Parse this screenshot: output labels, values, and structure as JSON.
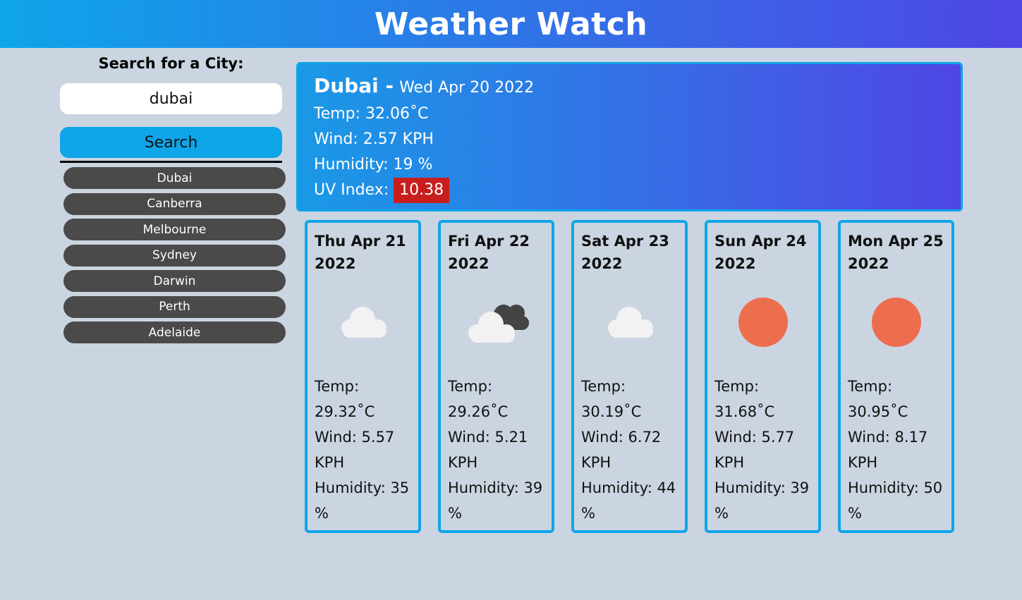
{
  "header": {
    "title": "Weather Watch"
  },
  "sidebar": {
    "search_title": "Search for a City:",
    "search_value": "dubai",
    "search_button": "Search",
    "history": [
      "Dubai",
      "Canberra",
      "Melbourne",
      "Sydney",
      "Darwin",
      "Perth",
      "Adelaide"
    ]
  },
  "current": {
    "city": "Dubai -",
    "date": "Wed Apr 20 2022",
    "temp": "Temp: 32.06˚C",
    "wind": "Wind: 2.57 KPH",
    "humidity": "Humidity: 19 %",
    "uv_label": "UV Index:",
    "uv_value": "10.38",
    "uv_color": "#c81e1e"
  },
  "forecast": [
    {
      "date": "Thu Apr 21 2022",
      "icon": "cloud-icon",
      "temp": "Temp: 29.32˚C",
      "wind": "Wind: 5.57 KPH",
      "humidity": "Humidity: 35 %"
    },
    {
      "date": "Fri Apr 22 2022",
      "icon": "broken-clouds-icon",
      "temp": "Temp: 29.26˚C",
      "wind": "Wind: 5.21 KPH",
      "humidity": "Humidity: 39 %"
    },
    {
      "date": "Sat Apr 23 2022",
      "icon": "cloud-icon",
      "temp": "Temp: 30.19˚C",
      "wind": "Wind: 6.72 KPH",
      "humidity": "Humidity: 44 %"
    },
    {
      "date": "Sun Apr 24 2022",
      "icon": "sun-icon",
      "temp": "Temp: 31.68˚C",
      "wind": "Wind: 5.77 KPH",
      "humidity": "Humidity: 39 %"
    },
    {
      "date": "Mon Apr 25 2022",
      "icon": "sun-icon",
      "temp": "Temp: 30.95˚C",
      "wind": "Wind: 8.17 KPH",
      "humidity": "Humidity: 50 %"
    }
  ],
  "colors": {
    "accent": "#0ea5e9",
    "gradient_end": "#4f46e5",
    "sun": "#ed6e4e"
  }
}
